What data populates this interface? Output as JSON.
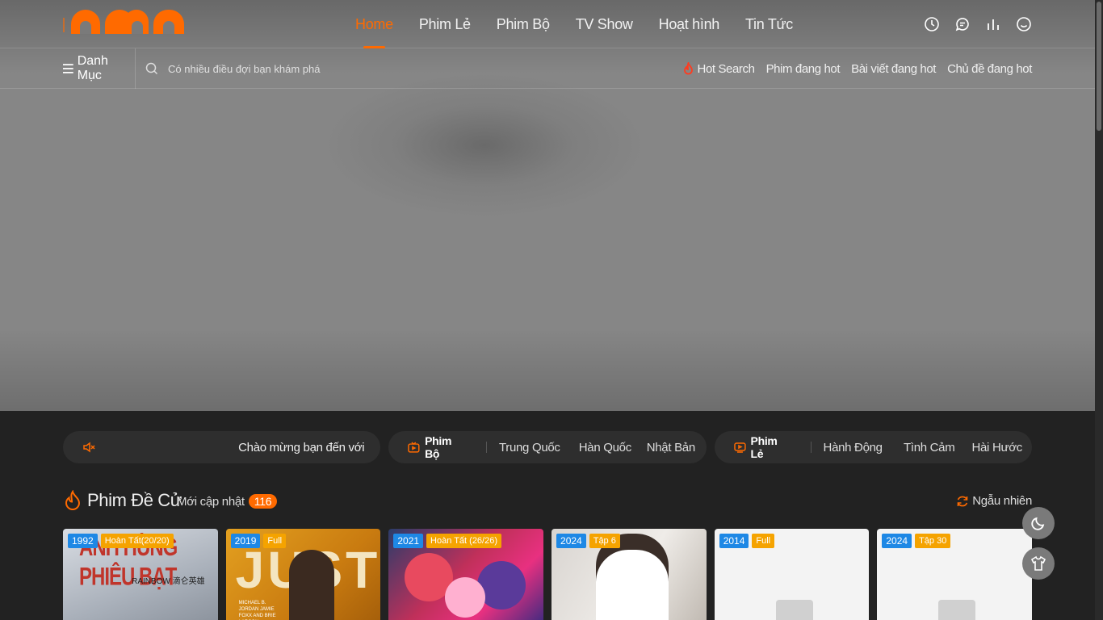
{
  "colors": {
    "accent": "#ff6a00",
    "year_badge": "#1e88e5",
    "status_badge": "#f5a300",
    "page_bg": "#222222"
  },
  "nav": {
    "logo_alt": "logo",
    "links": [
      "Home",
      "Phim Lẻ",
      "Phim Bộ",
      "TV Show",
      "Hoạt hình",
      "Tin Tức"
    ],
    "active_index": 0,
    "icons": [
      "history-icon",
      "chat-icon",
      "stats-icon",
      "smile-icon"
    ]
  },
  "subnav": {
    "category_label": "Danh Mục",
    "search_placeholder": "Có nhiều điều đợi bạn khám phá",
    "hot_search_label": "Hot Search",
    "hot_links": [
      "Phim đang hot",
      "Bài viết đang hot",
      "Chủ đề đang hot"
    ]
  },
  "filter": {
    "welcome": "Chào mừng bạn đến với",
    "series": {
      "label": "Phim Bộ",
      "categories": [
        "Trung Quốc",
        "Hàn Quốc",
        "Nhật Bản"
      ]
    },
    "movies": {
      "label": "Phim Lẻ",
      "categories": [
        "Hành Động",
        "Tình Cảm",
        "Hài Hước"
      ]
    }
  },
  "section": {
    "title": "Phim Đề Cử",
    "updated_label": "Mới cập nhật",
    "updated_count": "116",
    "random_label": "Ngẫu nhiên"
  },
  "cards": [
    {
      "year": "1992",
      "status": "Hoàn Tất(20/20)",
      "poster_text": "ANH HÙNG PHIÊU BẠT",
      "poster_sub": "RAINBOW 滴仑英雄"
    },
    {
      "year": "2019",
      "status": "Full",
      "poster_text": "JUST",
      "poster_sub": "MICHAEL B. JORDAN JAMIE FOXX AND BRIE LARSON"
    },
    {
      "year": "2021",
      "status": "Hoàn Tất (26/26)"
    },
    {
      "year": "2024",
      "status": "Tập 6"
    },
    {
      "year": "2014",
      "status": "Full"
    },
    {
      "year": "2024",
      "status": "Tập 30"
    }
  ]
}
